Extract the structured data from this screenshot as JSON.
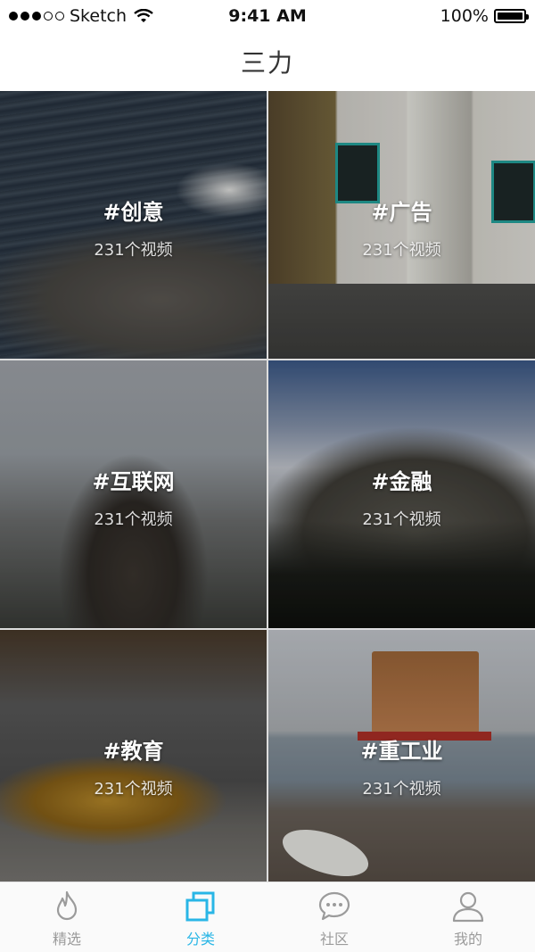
{
  "status_bar": {
    "carrier": "Sketch",
    "time": "9:41 AM",
    "battery": "100%"
  },
  "nav": {
    "title": "三力"
  },
  "categories": [
    {
      "title": "#创意",
      "count": "231个视频"
    },
    {
      "title": "#广告",
      "count": "231个视频"
    },
    {
      "title": "#互联网",
      "count": "231个视频"
    },
    {
      "title": "#金融",
      "count": "231个视频"
    },
    {
      "title": "#教育",
      "count": "231个视频"
    },
    {
      "title": "#重工业",
      "count": "231个视频"
    }
  ],
  "tabs": [
    {
      "label": "精选",
      "icon": "flame-icon"
    },
    {
      "label": "分类",
      "icon": "squares-icon"
    },
    {
      "label": "社区",
      "icon": "chat-icon"
    },
    {
      "label": "我的",
      "icon": "person-icon"
    }
  ],
  "colors": {
    "accent": "#29b6e6",
    "inactive": "#9b9b9b"
  }
}
